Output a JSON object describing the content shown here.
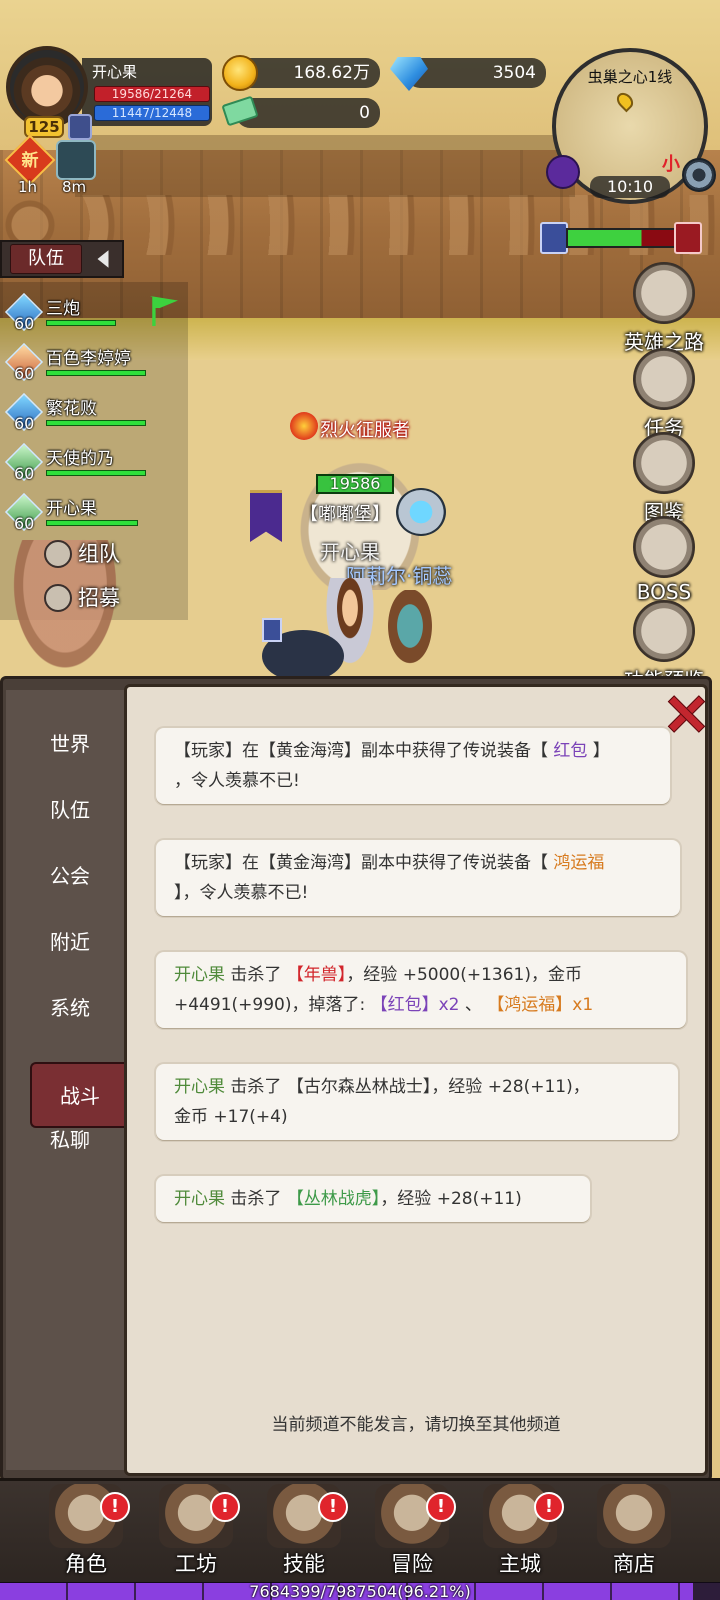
{
  "player": {
    "name": "开心果",
    "hp": "19586/21264",
    "mp": "11447/12448",
    "level": "125"
  },
  "currency": {
    "gold": "168.62万",
    "diamond": "3504",
    "ticket": "0"
  },
  "badges": {
    "new_label": "新",
    "new_timer": "1h",
    "buff_timer": "8m"
  },
  "minimap": {
    "title": "虫巢之心1线",
    "time": "10:10",
    "size_label": "小"
  },
  "faction": {
    "green_share": 0.68
  },
  "team": {
    "tab_label": "队伍",
    "members": [
      {
        "level": "60",
        "name": "三炮",
        "hp": 0.7
      },
      {
        "level": "60",
        "name": "百色李婷婷",
        "hp": 1.0
      },
      {
        "level": "60",
        "name": "繁花败",
        "hp": 1.0
      },
      {
        "level": "60",
        "name": "天使的乃",
        "hp": 1.0
      },
      {
        "level": "60",
        "name": "开心果",
        "hp": 0.92
      }
    ],
    "form_team": "组队",
    "recruit": "招募"
  },
  "side_menu": {
    "hero_road": "英雄之路",
    "quest": "任务",
    "codex": "图鉴",
    "boss": "BOSS",
    "preview": "功能预览"
  },
  "scene": {
    "title_tag": "烈火征服者",
    "player_hp": "19586",
    "guild": "【嘟嘟堡】",
    "player_name": "开心果",
    "pet_name": "阿莉尔·铜蕊"
  },
  "chat": {
    "tabs": [
      "世界",
      "队伍",
      "公会",
      "附近",
      "系统",
      "战斗",
      "私聊"
    ],
    "active_tab": "战斗",
    "messages": [
      {
        "a": "【玩家】在【黄金海湾】副本中获得了传说装备【 ",
        "item": "红包",
        "b": " 】",
        "line2": "，令人羡慕不已!"
      },
      {
        "a": "【玩家】在【黄金海湾】副本中获得了传说装备【 ",
        "item": "鸿运福",
        "line2": "】，令人羡慕不已!"
      },
      {
        "who": "开心果",
        "verb": " 击杀了 ",
        "target": "【年兽】",
        "rest": "，经验 +5000(+1361)，金币",
        "line2a": "+4491(+990)，掉落了: ",
        "drop1": "【红包】x2",
        "sep": " 、 ",
        "drop2": "【鸿运福】x1"
      },
      {
        "who": "开心果",
        "verb": " 击杀了 ",
        "target": "【古尔森丛林战士】",
        "rest": "，经验 +28(+11)，",
        "line2": "金币 +17(+4)"
      },
      {
        "who": "开心果",
        "verb": " 击杀了 ",
        "target": "【丛林战虎】",
        "rest": "，经验 +28(+11)"
      }
    ],
    "notice": "当前频道不能发言，请切换至其他频道"
  },
  "nav": {
    "items": [
      "角色",
      "工坊",
      "技能",
      "冒险",
      "主城",
      "商店"
    ],
    "alert": "!"
  },
  "exp": {
    "text": "7684399/7987504(96.21%)",
    "fraction": 0.9621
  }
}
